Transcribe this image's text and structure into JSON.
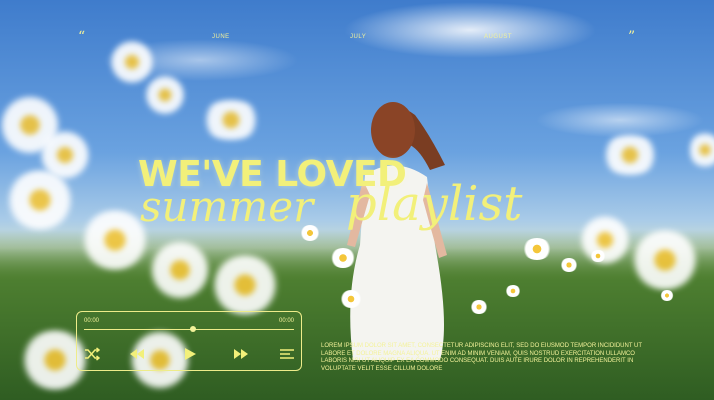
{
  "nav": {
    "quote_open": "“",
    "quote_close": "”",
    "months": [
      "JUNE",
      "JULY",
      "AUGUST"
    ]
  },
  "hero": {
    "headline": "WE'VE LOVED",
    "script_word_1": "summer",
    "script_word_2": "playlist"
  },
  "player": {
    "time_elapsed": "00:00",
    "time_total": "00:00",
    "progress": 0.52,
    "controls": [
      "shuffle-icon",
      "previous-icon",
      "play-icon",
      "next-icon",
      "playlist-icon"
    ]
  },
  "description": "Lorem ipsum dolor sit amet, consectetur adipiscing elit, sed do eiusmod tempor incididunt ut labore et dolore magna aliqua. Ut enim ad minim veniam, quis nostrud exercitation ullamco laboris nisi ut aliquip ex ea commodo consequat. Duis aute irure dolor in reprehenderit in voluptate velit esse cillum dolore",
  "colors": {
    "accent": "#f2f07a",
    "sky": "#4d87d2",
    "grass": "#3e6d2a"
  }
}
